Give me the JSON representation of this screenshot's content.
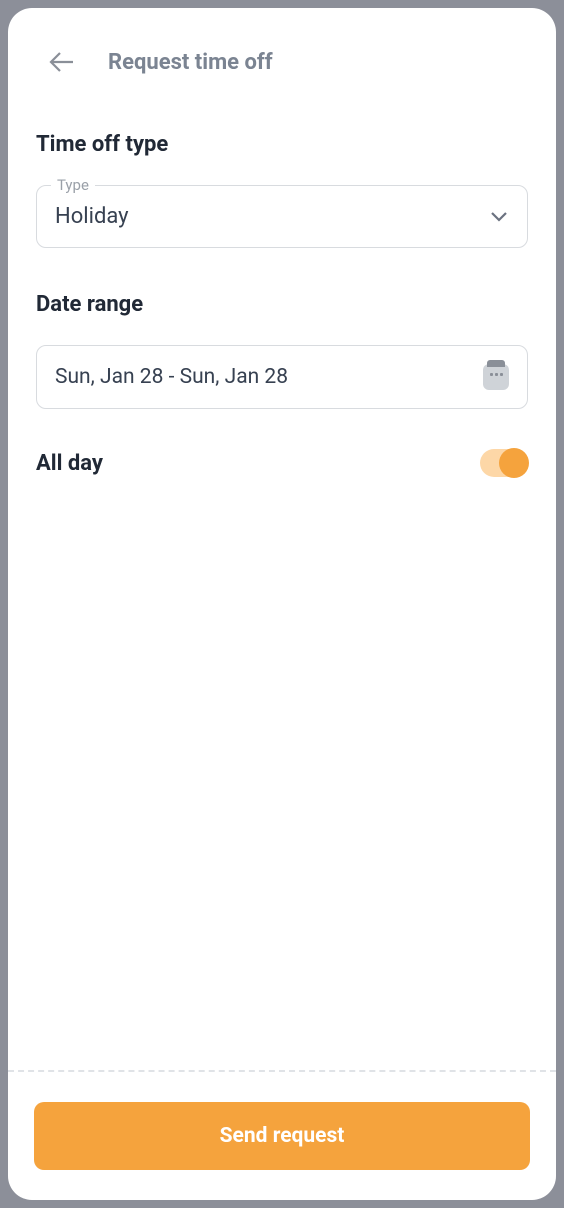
{
  "header": {
    "title": "Request time off"
  },
  "sections": {
    "type_label": "Time off type",
    "date_label": "Date range",
    "allday_label": "All day"
  },
  "type_field": {
    "legend": "Type",
    "value": "Holiday"
  },
  "date_field": {
    "value": "Sun, Jan 28 - Sun, Jan 28"
  },
  "all_day": {
    "enabled": true
  },
  "footer": {
    "submit_label": "Send request"
  },
  "colors": {
    "accent": "#f5a33d",
    "text_primary": "#212936",
    "text_muted": "#7b8492",
    "border": "#d8dbdf"
  }
}
